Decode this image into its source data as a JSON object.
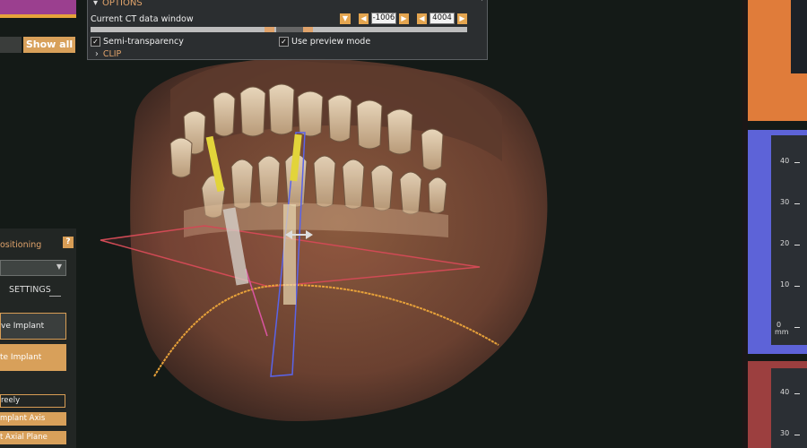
{
  "top_left": {
    "show_all_label": "Show all"
  },
  "options": {
    "header": "OPTIONS",
    "ct_window_label": "Current CT data window",
    "ct_min": "-1006",
    "ct_max": "4004",
    "semi_transparency_label": "Semi-transparency",
    "semi_transparency_checked": true,
    "preview_mode_label": "Use preview mode",
    "preview_mode_checked": true,
    "clip_label": "CLIP"
  },
  "left_panel": {
    "title": "ositioning",
    "help_label": "?",
    "settings_label": "SETTINGS",
    "move_implant": "ve Implant",
    "rotate_implant": "te Implant",
    "freely": "reely",
    "implant_axis": "mplant Axis",
    "axial_plane": "t Axial Plane"
  },
  "slices": {
    "mid_ticks": [
      "40",
      "30",
      "20",
      "10",
      "0"
    ],
    "mid_unit": "mm",
    "bottom_ticks": [
      "40",
      "30"
    ]
  },
  "icons": [
    "chevron-down-icon",
    "chevron-left-icon",
    "chevron-right-icon",
    "checkbox-check-icon",
    "help-icon",
    "dropdown-caret-icon",
    "implant-icon",
    "move-handle-icon"
  ],
  "colors": {
    "accent": "#d8a05a",
    "orange_panel": "#e07c3a",
    "blue_panel": "#5d63d8",
    "red_panel": "#9c3f3f",
    "purple_bar": "#9b3f8f"
  }
}
